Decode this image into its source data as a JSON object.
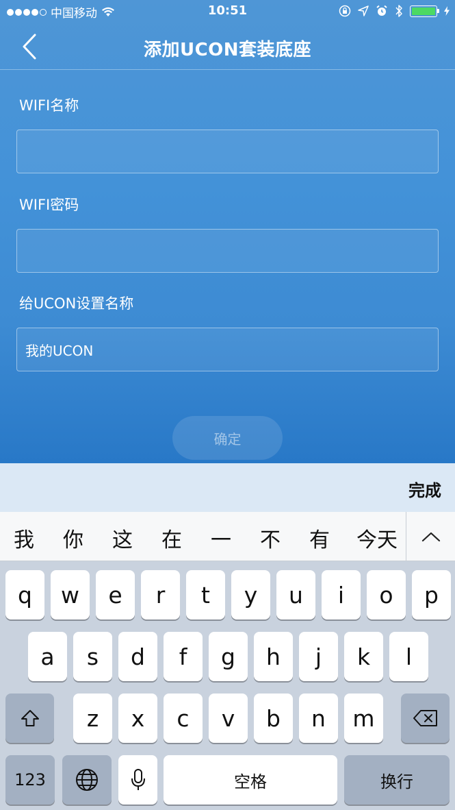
{
  "status_bar": {
    "carrier": "中国移动",
    "time": "10:51"
  },
  "nav": {
    "title": "添加UCON套装底座"
  },
  "form": {
    "wifi_name_label": "WIFI名称",
    "wifi_name_value": "",
    "wifi_password_label": "WIFI密码",
    "wifi_password_value": "",
    "device_name_label": "给UCON设置名称",
    "device_name_value": "我的UCON",
    "confirm_label": "确定"
  },
  "keyboard_toolbar": {
    "done_label": "完成"
  },
  "candidates": [
    "我",
    "你",
    "这",
    "在",
    "一",
    "不",
    "有",
    "今天"
  ],
  "keyboard": {
    "row1": [
      "q",
      "w",
      "e",
      "r",
      "t",
      "y",
      "u",
      "i",
      "o",
      "p"
    ],
    "row2": [
      "a",
      "s",
      "d",
      "f",
      "g",
      "h",
      "j",
      "k",
      "l"
    ],
    "row3": [
      "z",
      "x",
      "c",
      "v",
      "b",
      "n",
      "m"
    ],
    "numbers_label": "123",
    "space_label": "空格",
    "return_label": "换行"
  },
  "colors": {
    "accent_blue": "#4392d8",
    "battery_green": "#4cd964",
    "keyboard_bg": "#c9d2de"
  }
}
